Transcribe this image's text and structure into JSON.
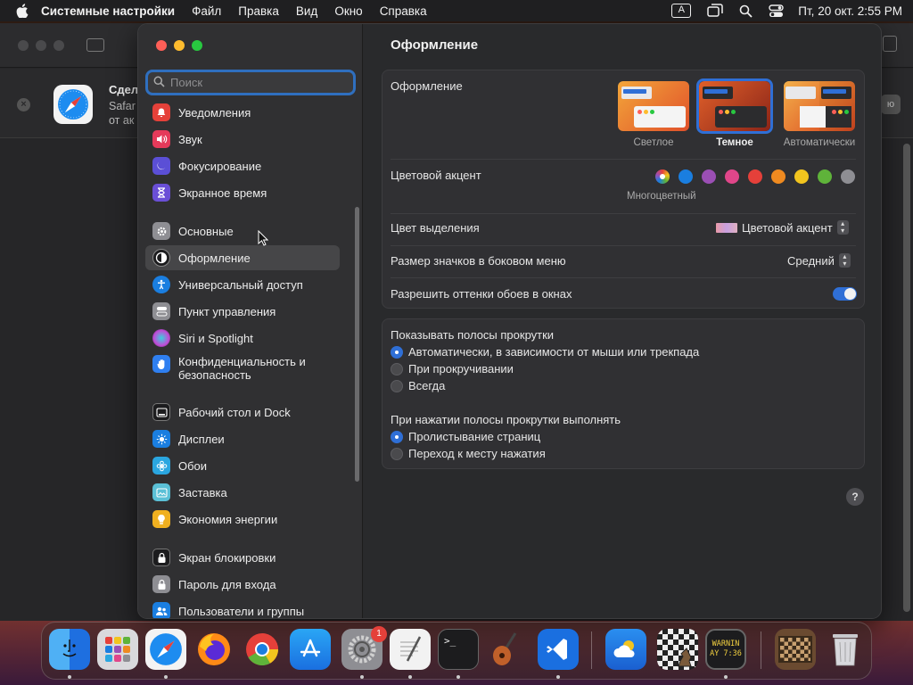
{
  "menubar": {
    "app_name": "Системные настройки",
    "menus": [
      "Файл",
      "Правка",
      "Вид",
      "Окно",
      "Справка"
    ],
    "input_indicator": "A",
    "clock": "Пт, 20 окт.  2:55 PM"
  },
  "background_window": {
    "banner_title": "Сдел",
    "banner_sub_1": "Safar",
    "banner_sub_2": "от ак",
    "banner_button": "ю"
  },
  "sidebar": {
    "search_placeholder": "Поиск",
    "items": [
      {
        "label": "Уведомления",
        "color": "#e5413a"
      },
      {
        "label": "Звук",
        "color": "#e53a5a"
      },
      {
        "label": "Фокусирование",
        "color": "#5b4fd6"
      },
      {
        "label": "Экранное время",
        "color": "#6a4fd6"
      },
      {
        "label": "Основные",
        "color": "#8e8e93"
      },
      {
        "label": "Оформление",
        "color": "#1c1c1e"
      },
      {
        "label": "Универсальный доступ",
        "color": "#1a7ee0"
      },
      {
        "label": "Пункт управления",
        "color": "#8e8e93"
      },
      {
        "label": "Siri и Spotlight",
        "color": "#c24bd6"
      },
      {
        "label": "Конфиденциальность и безопасность",
        "color": "#2f7ff0"
      },
      {
        "label": "Рабочий стол и Dock",
        "color": "#1c1c1e"
      },
      {
        "label": "Дисплеи",
        "color": "#1a7ee0"
      },
      {
        "label": "Обои",
        "color": "#2aa6e0"
      },
      {
        "label": "Заставка",
        "color": "#5bc0d6"
      },
      {
        "label": "Экономия энергии",
        "color": "#f0b020"
      },
      {
        "label": "Экран блокировки",
        "color": "#1c1c1e"
      },
      {
        "label": "Пароль для входа",
        "color": "#8e8e93"
      },
      {
        "label": "Пользователи и группы",
        "color": "#1a7ee0"
      }
    ]
  },
  "content": {
    "title": "Оформление",
    "appearance": {
      "label": "Оформление",
      "options": [
        "Светлое",
        "Темное",
        "Автоматически"
      ],
      "selected": "Темное"
    },
    "accent": {
      "label": "Цветовой акцент",
      "caption": "Многоцветный",
      "colors": [
        "#1a7ee0",
        "#9b4fb5",
        "#e0468a",
        "#e5403a",
        "#ef8a20",
        "#f2c41e",
        "#5fb33a",
        "#8e8e93"
      ]
    },
    "highlight": {
      "label": "Цвет выделения",
      "value": "Цветовой акцент"
    },
    "sidebar_icon_size": {
      "label": "Размер значков в боковом меню",
      "value": "Средний"
    },
    "wallpaper_tint": {
      "label": "Разрешить оттенки обоев в окнах",
      "on": true
    },
    "scrollbars": {
      "label": "Показывать полосы прокрутки",
      "options": [
        "Автоматически, в зависимости от мыши или трекпада",
        "При прокручивании",
        "Всегда"
      ],
      "selected": 0
    },
    "click_scrollbar": {
      "label": "При нажатии полосы прокрутки выполнять",
      "options": [
        "Пролистывание страниц",
        "Переход к месту нажатия"
      ],
      "selected": 0
    },
    "help": "?"
  },
  "dock": {
    "settings_badge": "1",
    "console_text_1": "WARNIN",
    "console_text_2": "AY 7:36"
  }
}
